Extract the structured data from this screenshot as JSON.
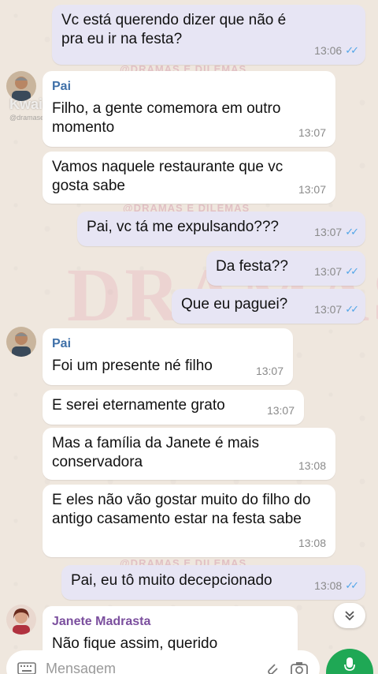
{
  "messages": [
    {
      "text": "Vc está querendo dizer que não é pra eu ir na festa?",
      "time": "13:06",
      "dir": "out"
    },
    {
      "sender": "Pai",
      "text": "Filho, a gente comemora em outro momento",
      "time": "13:07",
      "dir": "in"
    },
    {
      "text": "Vamos naquele restaurante que vc gosta sabe",
      "time": "13:07",
      "dir": "in"
    },
    {
      "text": "Pai, vc tá me expulsando???",
      "time": "13:07",
      "dir": "out"
    },
    {
      "text": "Da festa??",
      "time": "13:07",
      "dir": "out"
    },
    {
      "text": "Que eu paguei?",
      "time": "13:07",
      "dir": "out"
    },
    {
      "sender": "Pai",
      "text": "Foi um presente né filho",
      "time": "13:07",
      "dir": "in"
    },
    {
      "text": "E serei eternamente grato",
      "time": "13:07",
      "dir": "in"
    },
    {
      "text": "Mas a família da Janete é mais conservadora",
      "time": "13:08",
      "dir": "in"
    },
    {
      "text": "E eles não vão gostar muito do filho do antigo casamento estar na festa sabe",
      "time": "13:08",
      "dir": "in"
    },
    {
      "text": "Pai, eu tô muito decepcionado",
      "time": "13:08",
      "dir": "out"
    },
    {
      "sender": "Janete Madrasta",
      "text": "Não fique assim, querido",
      "dir": "in"
    }
  ],
  "watermark": {
    "big": "DRAMAS",
    "small1": "@DRAMAS E DILEMAS",
    "small2": "@DRAMAS E DILEMAS",
    "small3": "@DRAMAS E DILEMAS",
    "logo": "Kwai",
    "handle": "@dramasedilemas"
  },
  "input": {
    "placeholder": "Mensagem"
  },
  "colors": {
    "outgoing_bubble": "#e7e5f4",
    "incoming_bubble": "#ffffff",
    "read_ticks": "#53a6e8",
    "mic_button": "#1fa855",
    "pai_name": "#3f70a8",
    "janete_name": "#7b4f9e"
  }
}
